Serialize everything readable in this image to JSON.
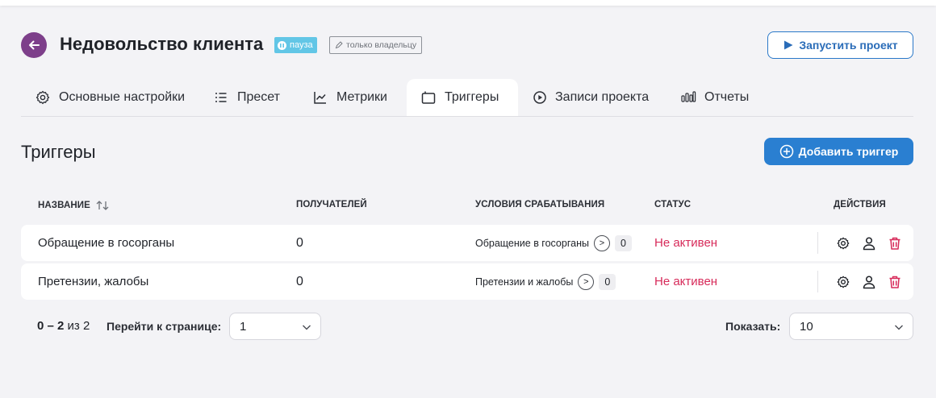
{
  "header": {
    "title": "Недовольство клиента",
    "status_badge": "пауза",
    "owner_badge": "только владельцу",
    "start_button": "Запустить проект"
  },
  "tabs": [
    {
      "label": "Основные настройки",
      "icon": "gear-icon"
    },
    {
      "label": "Пресет",
      "icon": "list-icon"
    },
    {
      "label": "Метрики",
      "icon": "chart-line-icon"
    },
    {
      "label": "Триггеры",
      "icon": "trigger-icon",
      "active": true
    },
    {
      "label": "Записи проекта",
      "icon": "play-circle-icon"
    },
    {
      "label": "Отчеты",
      "icon": "bars-icon"
    }
  ],
  "section": {
    "title": "Триггеры",
    "add_button": "Добавить триггер"
  },
  "table": {
    "columns": [
      "НАЗВАНИЕ",
      "ПОЛУЧАТЕЛЕЙ",
      "УСЛОВИЯ СРАБАТЫВАНИЯ",
      "СТАТУС",
      "ДЕЙСТВИЯ"
    ],
    "rows": [
      {
        "name": "Обращение в госорганы",
        "recipients": "0",
        "condition": "Обращение в госорганы",
        "condition_count": "0",
        "status": "Не активен"
      },
      {
        "name": "Претензии, жалобы",
        "recipients": "0",
        "condition": "Претензии и жалобы",
        "condition_count": "0",
        "status": "Не активен"
      }
    ]
  },
  "pagination": {
    "range": "0 – 2",
    "of_text": "из 2",
    "goto_label": "Перейти к странице:",
    "page_value": "1",
    "show_label": "Показать:",
    "page_size": "10"
  },
  "colors": {
    "accent": "#2a7fd1",
    "back_button": "#7d3f8a",
    "pause_badge": "#62c6e6",
    "status_inactive": "#d72b5a",
    "delete_icon": "#d72b5a"
  }
}
